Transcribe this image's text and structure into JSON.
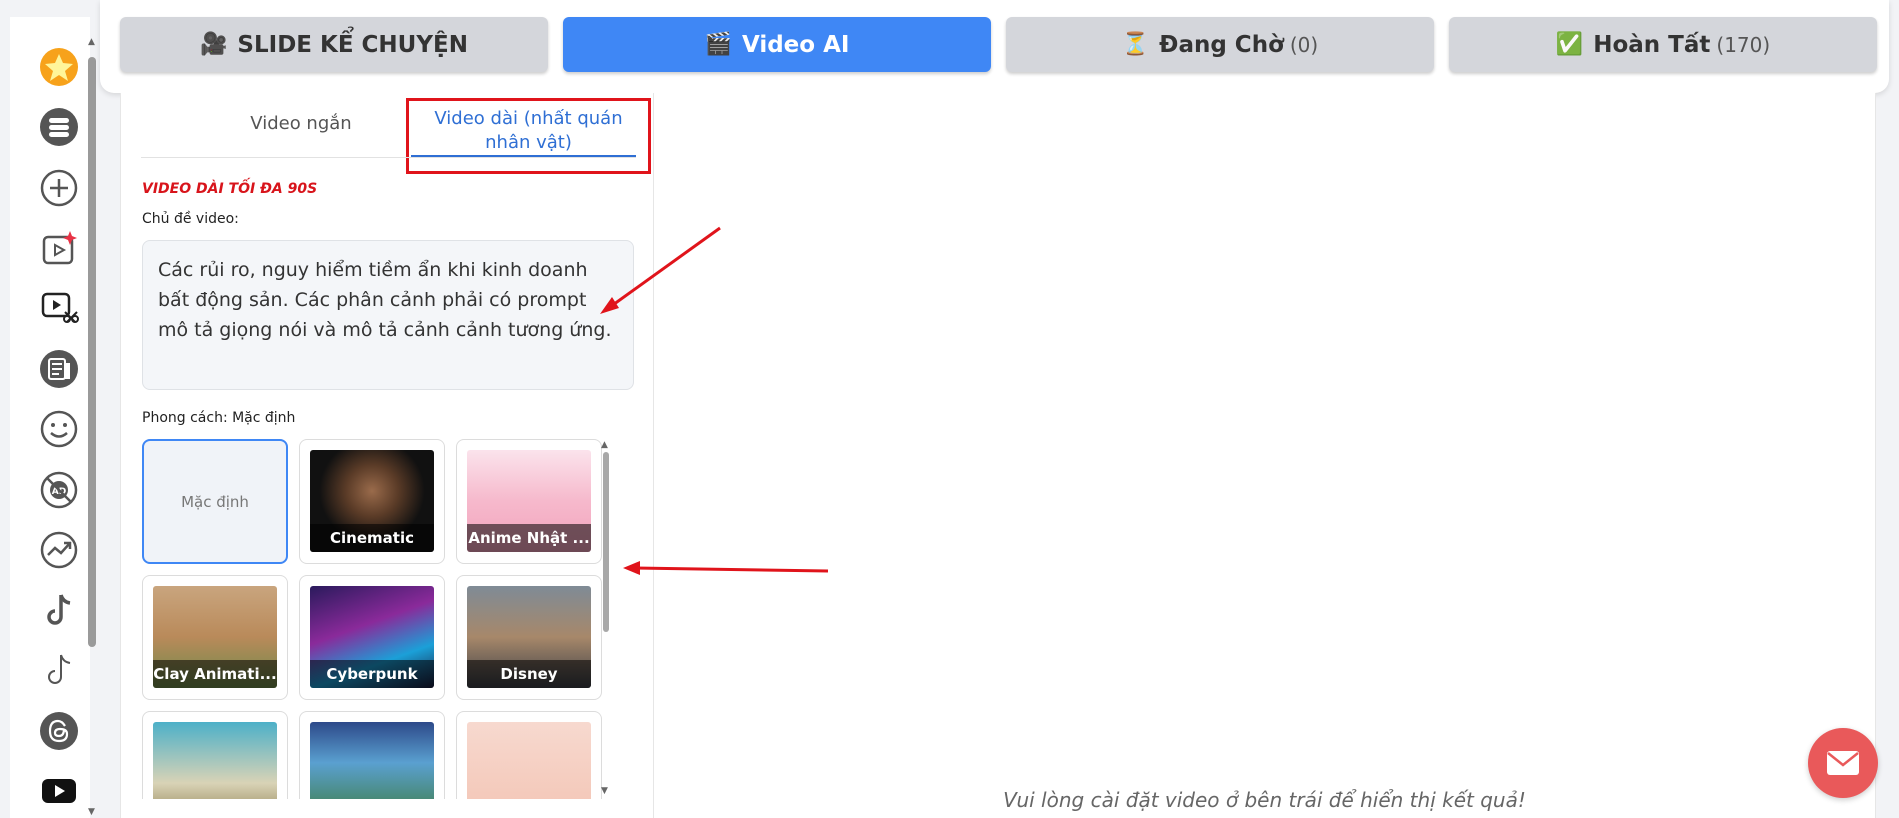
{
  "sidebar": {
    "icons": [
      "star-icon",
      "layers-icon",
      "plus-circle-icon",
      "video-sparkle-icon",
      "video-cut-icon",
      "article-icon",
      "smile-icon",
      "ad-icon",
      "trend-icon",
      "tiktok-icon",
      "tiktok-outline-icon",
      "threads-icon",
      "youtube-icon"
    ]
  },
  "tabs": [
    {
      "icon": "🎥",
      "label": "SLIDE KỂ CHUYỆN",
      "count": ""
    },
    {
      "icon": "🎬",
      "label": "Video AI",
      "count": ""
    },
    {
      "icon": "⏳",
      "label": "Đang Chờ",
      "count": "(0)"
    },
    {
      "icon": "✅",
      "label": "Hoàn Tất",
      "count": "(170)"
    }
  ],
  "form": {
    "subtab_short": "Video ngắn",
    "subtab_long_line1": "Video dài (nhất quán",
    "subtab_long_line2": "nhân vật)",
    "limit_label": "VIDEO DÀI TỐI ĐA 90S",
    "topic_label": "Chủ đề video:",
    "topic_value": "Các rủi ro, nguy hiểm tiềm ẩn khi kinh doanh bất động sản. Các phân cảnh phải có prompt mô tả giọng nói và mô tả cảnh cảnh tương ứng.",
    "style_label": "Phong cách: Mặc định",
    "styles": [
      {
        "name": "Mặc định",
        "selected": true
      },
      {
        "name": "Cinematic"
      },
      {
        "name": "Anime Nhật ..."
      },
      {
        "name": "Clay Animati..."
      },
      {
        "name": "Cyberpunk"
      },
      {
        "name": "Disney"
      },
      {
        "name": ""
      },
      {
        "name": ""
      },
      {
        "name": ""
      }
    ]
  },
  "result": {
    "placeholder": "Vui lòng cài đặt video ở bên trái để hiển thị kết quả!"
  },
  "colors": {
    "accent": "#3f87f5",
    "annotation": "#e0141b",
    "mail": "#e9595a"
  }
}
